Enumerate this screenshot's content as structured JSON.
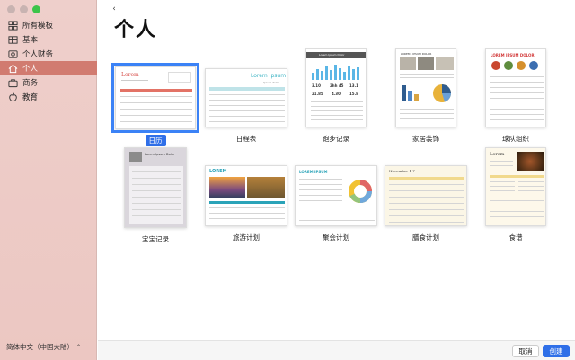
{
  "sidebar": {
    "items": [
      {
        "label": "所有模板",
        "icon": "grid-icon"
      },
      {
        "label": "基本",
        "icon": "table-icon"
      },
      {
        "label": "个人财务",
        "icon": "finance-icon"
      },
      {
        "label": "个人",
        "icon": "home-icon",
        "active": true
      },
      {
        "label": "商务",
        "icon": "briefcase-icon"
      },
      {
        "label": "教育",
        "icon": "apple-icon"
      }
    ],
    "language": "简体中文（中国大陆）"
  },
  "main": {
    "title": "个人",
    "back_icon": "chevron-left-icon",
    "templates": [
      {
        "label": "日历",
        "selected": true,
        "thumb_title": "Lorem"
      },
      {
        "label": "日程表",
        "thumb_title": "Lorem Ipsum",
        "thumb_subtitle": "Ipsum dolor"
      },
      {
        "label": "跑步记录",
        "thumb_title": "Lorem Ipsum Dolor",
        "stats": [
          "3.10",
          "2hh 45",
          "13.1",
          "21.85",
          "4.30",
          "15.8"
        ]
      },
      {
        "label": "家居装饰",
        "thumb_title": "LOREM · IPSUM DOLOR"
      },
      {
        "label": "球队组织",
        "thumb_title": "LOREM IPSUM DOLOR"
      },
      {
        "label": "宝宝记录",
        "thumb_title": "Lorem Ipsum Dolor"
      },
      {
        "label": "旅游计划",
        "thumb_title": "LOREM"
      },
      {
        "label": "聚会计划",
        "thumb_title": "LOREM IPSUM"
      },
      {
        "label": "膳食计划",
        "thumb_title": "November 1-7"
      },
      {
        "label": "食谱",
        "thumb_title": "Lorem"
      }
    ]
  },
  "footer": {
    "cancel_label": "取消",
    "create_label": "创建"
  },
  "colors": {
    "sidebar_bg": "#ecc7c2",
    "active_item": "#d17b70",
    "accent": "#2f6fe8"
  }
}
